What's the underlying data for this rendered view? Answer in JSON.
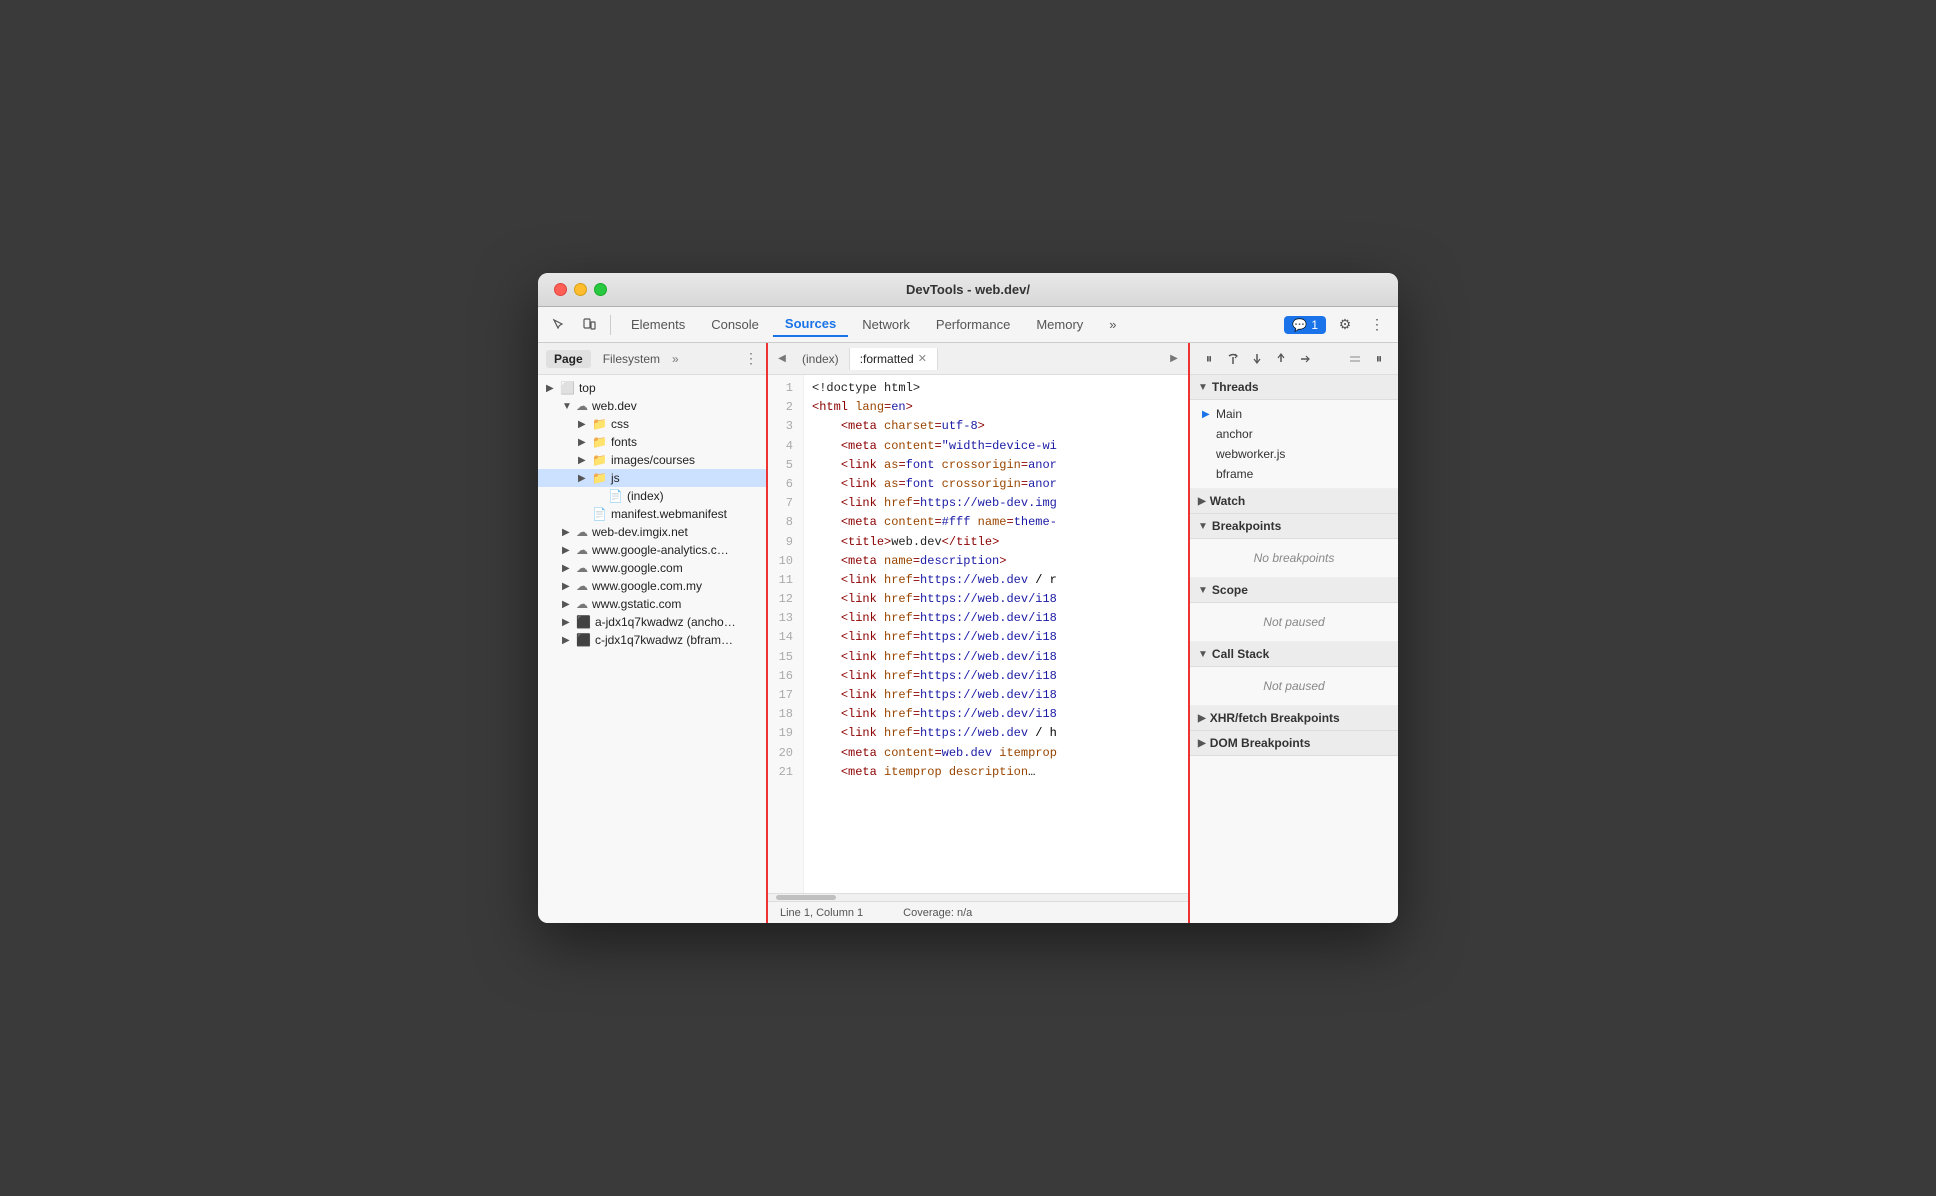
{
  "window": {
    "title": "DevTools - web.dev/"
  },
  "toolbar": {
    "tabs": [
      {
        "label": "Elements",
        "active": false
      },
      {
        "label": "Console",
        "active": false
      },
      {
        "label": "Sources",
        "active": true
      },
      {
        "label": "Network",
        "active": false
      },
      {
        "label": "Performance",
        "active": false
      },
      {
        "label": "Memory",
        "active": false
      }
    ],
    "more_label": "»",
    "badge_count": "1",
    "settings_icon": "⚙",
    "more_icon": "⋮"
  },
  "left_panel": {
    "tabs": [
      {
        "label": "Page",
        "active": true
      },
      {
        "label": "Filesystem",
        "active": false
      }
    ],
    "more_label": "»",
    "menu_icon": "⋮",
    "tree": [
      {
        "level": 1,
        "type": "folder-expand",
        "label": "top",
        "expanded": true,
        "arrow": "▶"
      },
      {
        "level": 2,
        "type": "cloud",
        "label": "web.dev",
        "expanded": true,
        "arrow": "▼"
      },
      {
        "level": 3,
        "type": "folder",
        "label": "css",
        "expanded": false,
        "arrow": "▶"
      },
      {
        "level": 3,
        "type": "folder",
        "label": "fonts",
        "expanded": false,
        "arrow": "▶"
      },
      {
        "level": 3,
        "type": "folder",
        "label": "images/courses",
        "expanded": false,
        "arrow": "▶"
      },
      {
        "level": 3,
        "type": "folder",
        "label": "js",
        "expanded": false,
        "arrow": "▶",
        "selected": true
      },
      {
        "level": 4,
        "type": "file",
        "label": "(index)",
        "expanded": false,
        "arrow": ""
      },
      {
        "level": 3,
        "type": "file",
        "label": "manifest.webmanifest",
        "expanded": false,
        "arrow": ""
      },
      {
        "level": 2,
        "type": "cloud",
        "label": "web-dev.imgix.net",
        "expanded": false,
        "arrow": "▶"
      },
      {
        "level": 2,
        "type": "cloud",
        "label": "www.google-analytics.c…",
        "expanded": false,
        "arrow": "▶"
      },
      {
        "level": 2,
        "type": "cloud",
        "label": "www.google.com",
        "expanded": false,
        "arrow": "▶"
      },
      {
        "level": 2,
        "type": "cloud",
        "label": "www.google.com.my",
        "expanded": false,
        "arrow": "▶"
      },
      {
        "level": 2,
        "type": "cloud",
        "label": "www.gstatic.com",
        "expanded": false,
        "arrow": "▶"
      },
      {
        "level": 2,
        "type": "frame",
        "label": "a-jdx1q7kwadwz (ancho…",
        "expanded": false,
        "arrow": "▶"
      },
      {
        "level": 2,
        "type": "frame",
        "label": "c-jdx1q7kwadwz (bfram…",
        "expanded": false,
        "arrow": "▶"
      }
    ]
  },
  "editor": {
    "tabs": [
      {
        "label": "(index)",
        "active": false
      },
      {
        "label": ":formatted",
        "active": true,
        "closable": true
      }
    ],
    "lines": [
      {
        "num": 1,
        "content": "<!doctype html>",
        "type": "plain"
      },
      {
        "num": 2,
        "content": "<html lang=en>",
        "type": "tag-line"
      },
      {
        "num": 3,
        "content": "    <meta charset=utf-8>",
        "type": "tag-line"
      },
      {
        "num": 4,
        "content": "    <meta content=\"width=device-wi",
        "type": "tag-line"
      },
      {
        "num": 5,
        "content": "    <link as=font crossorigin=anor",
        "type": "tag-line"
      },
      {
        "num": 6,
        "content": "    <link as=font crossorigin=anor",
        "type": "tag-line"
      },
      {
        "num": 7,
        "content": "    <link href=https://web-dev.img",
        "type": "tag-line"
      },
      {
        "num": 8,
        "content": "    <meta content=#fff name=theme-",
        "type": "tag-line"
      },
      {
        "num": 9,
        "content": "    <title>web.dev</title>",
        "type": "tag-line"
      },
      {
        "num": 10,
        "content": "    <meta name=description>",
        "type": "tag-line"
      },
      {
        "num": 11,
        "content": "    <link href=https://web.dev / r",
        "type": "tag-line"
      },
      {
        "num": 12,
        "content": "    <link href=https://web.dev/i18",
        "type": "tag-line"
      },
      {
        "num": 13,
        "content": "    <link href=https://web.dev/i18",
        "type": "tag-line"
      },
      {
        "num": 14,
        "content": "    <link href=https://web.dev/i18",
        "type": "tag-line"
      },
      {
        "num": 15,
        "content": "    <link href=https://web.dev/i18",
        "type": "tag-line"
      },
      {
        "num": 16,
        "content": "    <link href=https://web.dev/i18",
        "type": "tag-line"
      },
      {
        "num": 17,
        "content": "    <link href=https://web.dev/i18",
        "type": "tag-line"
      },
      {
        "num": 18,
        "content": "    <link href=https://web.dev/i18",
        "type": "tag-line"
      },
      {
        "num": 19,
        "content": "    <link href=https://web.dev / h",
        "type": "tag-line"
      },
      {
        "num": 20,
        "content": "    <meta content=web.dev itemprop",
        "type": "tag-line"
      },
      {
        "num": 21,
        "content": "    <meta itemprop description…",
        "type": "tag-line"
      }
    ],
    "status_line": "Line 1, Column 1",
    "status_coverage": "Coverage: n/a"
  },
  "right_panel": {
    "toolbar_btns": [
      "⏸",
      "↩",
      "⬇",
      "⬆",
      "⤵",
      "✏",
      "⏸"
    ],
    "sections": [
      {
        "label": "Threads",
        "expanded": true,
        "items": [
          {
            "label": "Main",
            "is_arrow": true
          },
          {
            "label": "anchor",
            "is_arrow": false
          },
          {
            "label": "webworker.js",
            "is_arrow": false
          },
          {
            "label": "bframe",
            "is_arrow": false
          }
        ]
      },
      {
        "label": "Watch",
        "expanded": false,
        "items": []
      },
      {
        "label": "Breakpoints",
        "expanded": true,
        "items": [],
        "empty_label": "No breakpoints"
      },
      {
        "label": "Scope",
        "expanded": true,
        "items": [],
        "empty_label": "Not paused"
      },
      {
        "label": "Call Stack",
        "expanded": true,
        "items": [],
        "empty_label": "Not paused"
      },
      {
        "label": "XHR/fetch Breakpoints",
        "expanded": false,
        "items": []
      },
      {
        "label": "DOM Breakpoints",
        "expanded": false,
        "items": []
      }
    ]
  }
}
